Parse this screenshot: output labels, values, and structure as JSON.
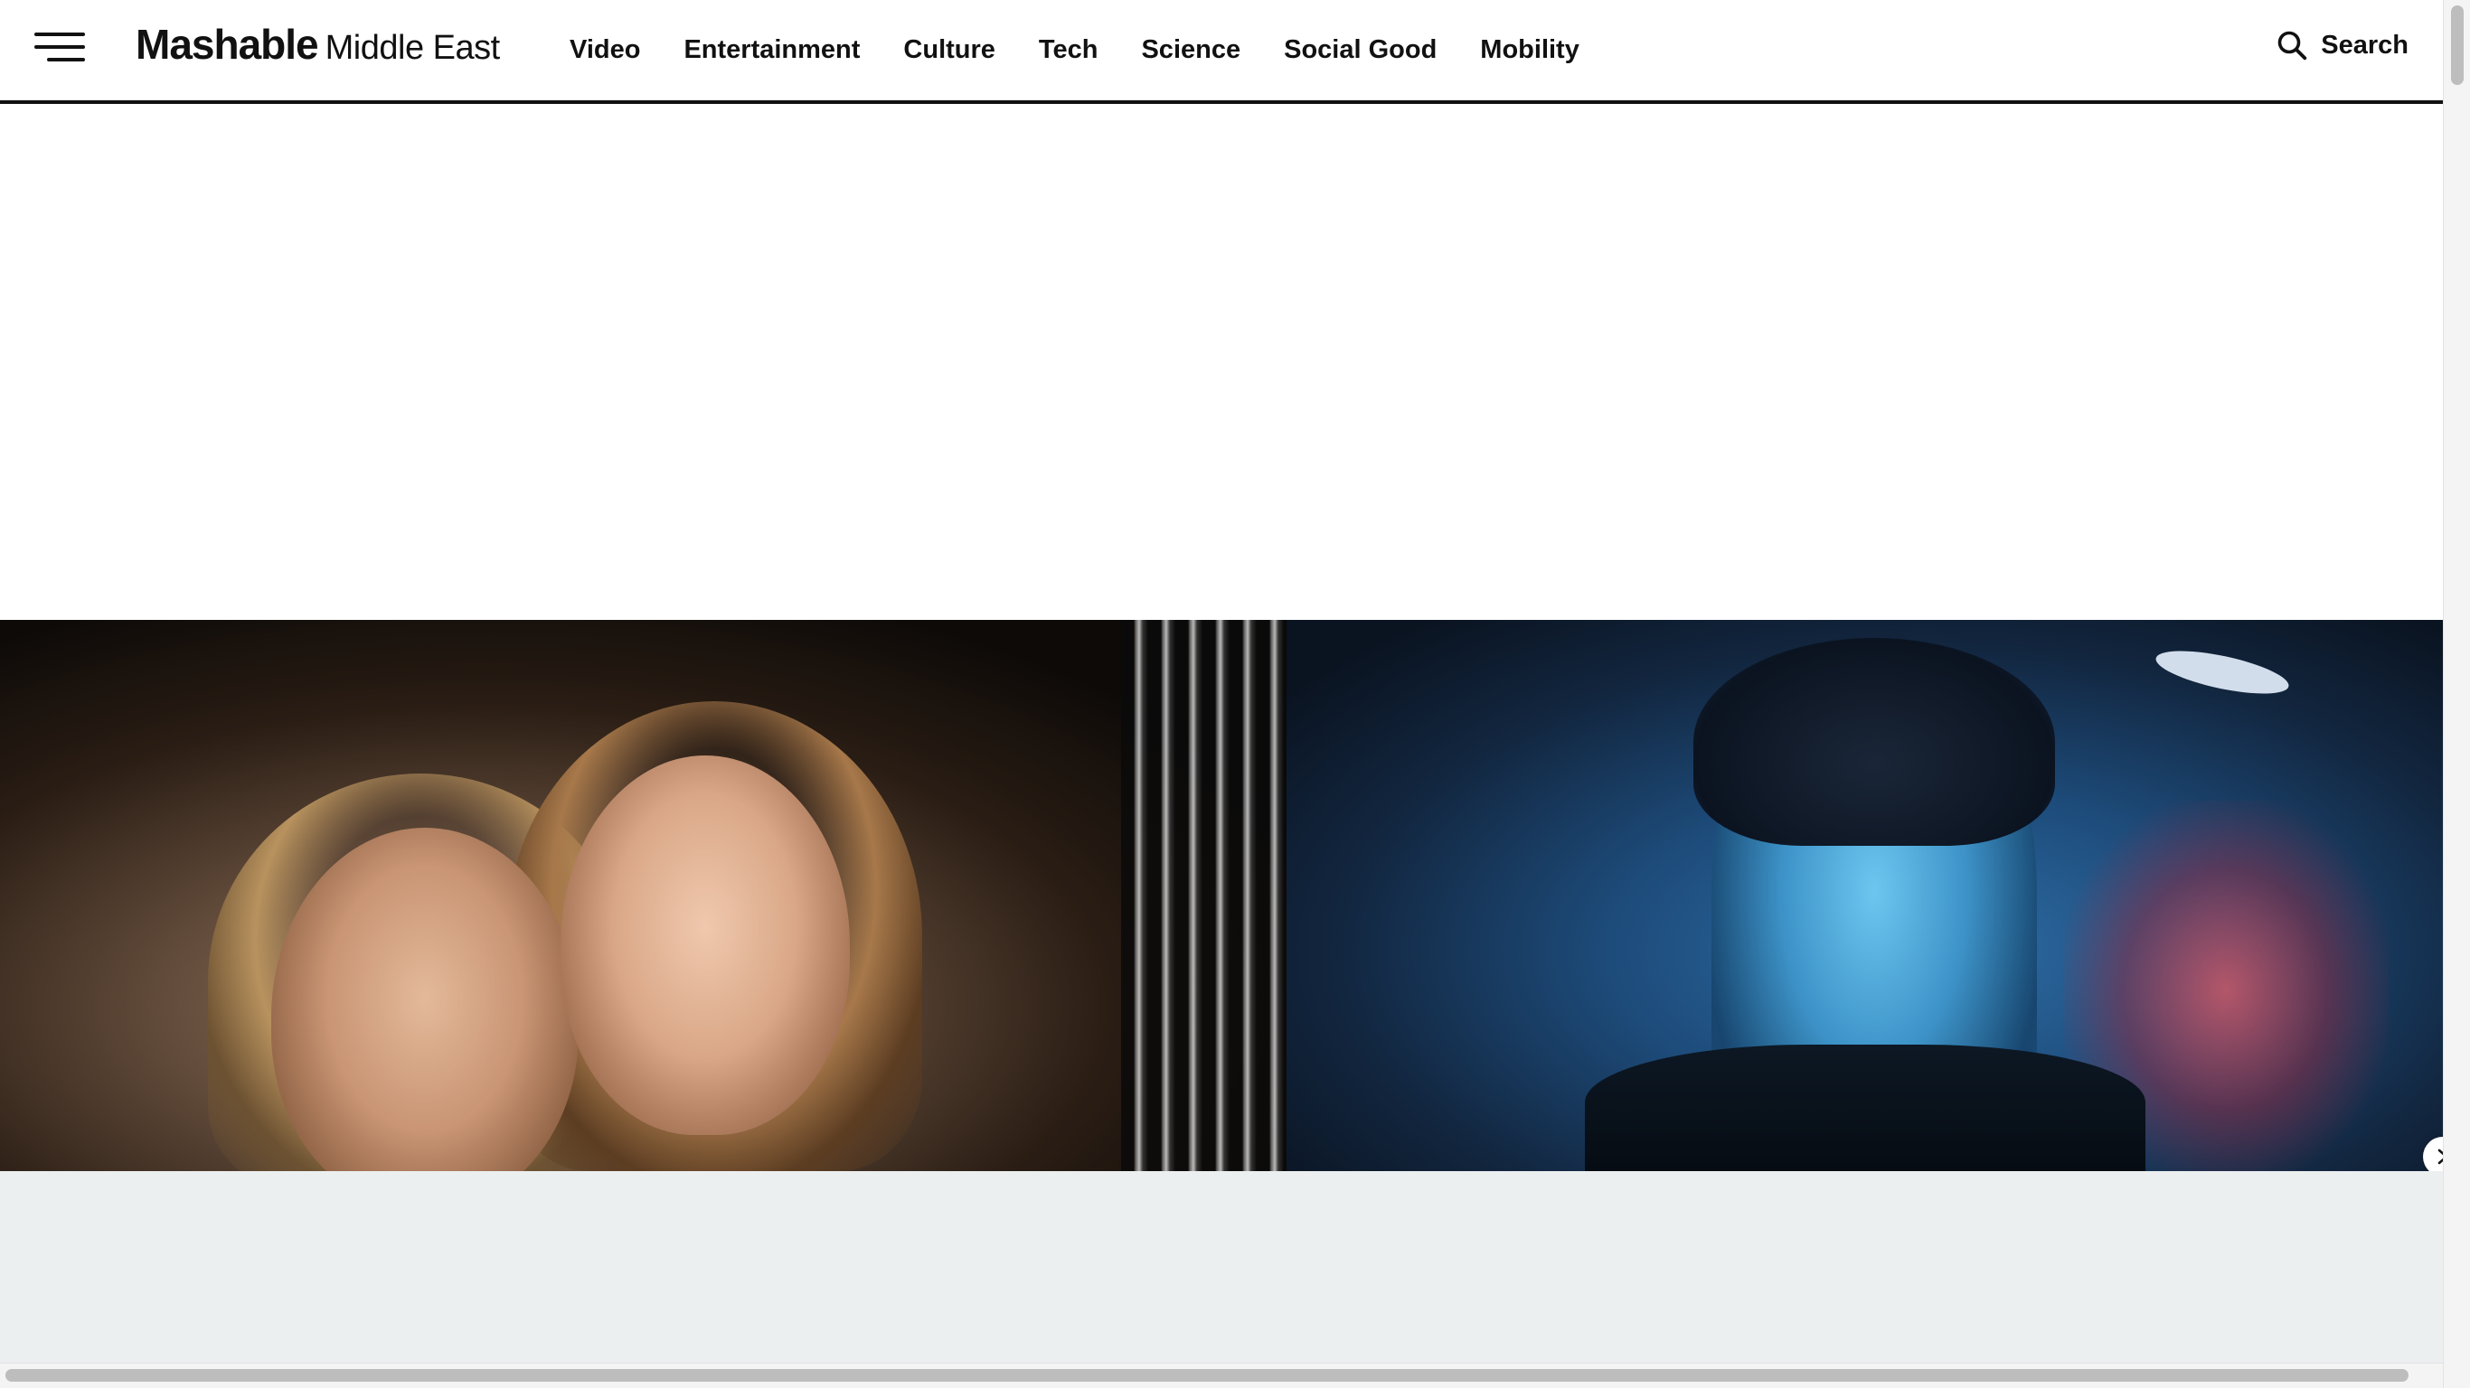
{
  "header": {
    "menu_icon": "hamburger-menu-icon",
    "logo_main": "Mashable",
    "logo_sub": "Middle East",
    "nav_items": [
      {
        "label": "Video"
      },
      {
        "label": "Entertainment"
      },
      {
        "label": "Culture"
      },
      {
        "label": "Tech"
      },
      {
        "label": "Science"
      },
      {
        "label": "Social Good"
      },
      {
        "label": "Mobility"
      }
    ],
    "search_label": "Search",
    "search_icon": "search-icon"
  },
  "carousel": {
    "items": [
      {
        "image": "photo-two-women-portrait"
      },
      {
        "image": "photo-woman-blue-lighting"
      }
    ],
    "next_icon": "chevron-right-icon"
  },
  "colors": {
    "text": "#111111",
    "background": "#ffffff",
    "band": "#eceff0"
  }
}
